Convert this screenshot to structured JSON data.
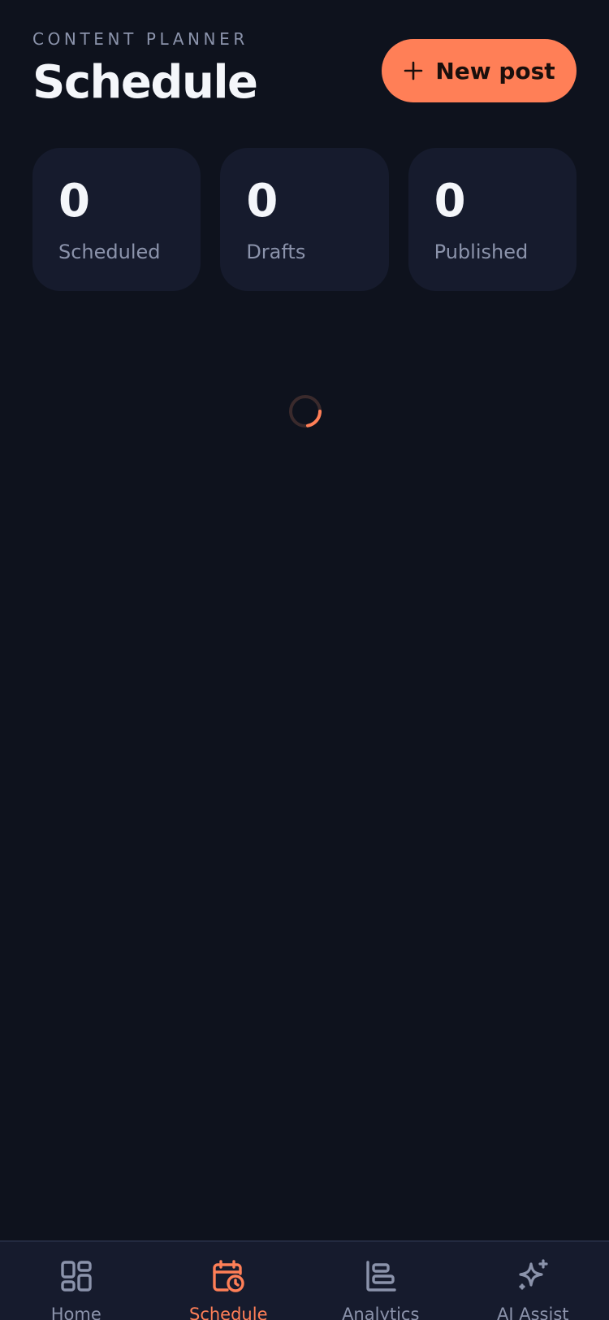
{
  "header": {
    "eyebrow": "CONTENT PLANNER",
    "title": "Schedule",
    "new_post_label": "New post"
  },
  "stats": [
    {
      "value": "0",
      "label": "Scheduled"
    },
    {
      "value": "0",
      "label": "Drafts"
    },
    {
      "value": "0",
      "label": "Published"
    }
  ],
  "nav": {
    "items": [
      {
        "label": "Home",
        "icon": "grid-icon"
      },
      {
        "label": "Schedule",
        "icon": "calendar-clock-icon",
        "active": true
      },
      {
        "label": "Analytics",
        "icon": "bar-chart-icon"
      },
      {
        "label": "AI Assist",
        "icon": "sparkle-icon"
      }
    ]
  },
  "colors": {
    "background": "#0e121d",
    "card": "#161b2d",
    "accent": "#ff7f57",
    "muted_text": "#8b93ab",
    "primary_text": "#f4f6fa"
  }
}
